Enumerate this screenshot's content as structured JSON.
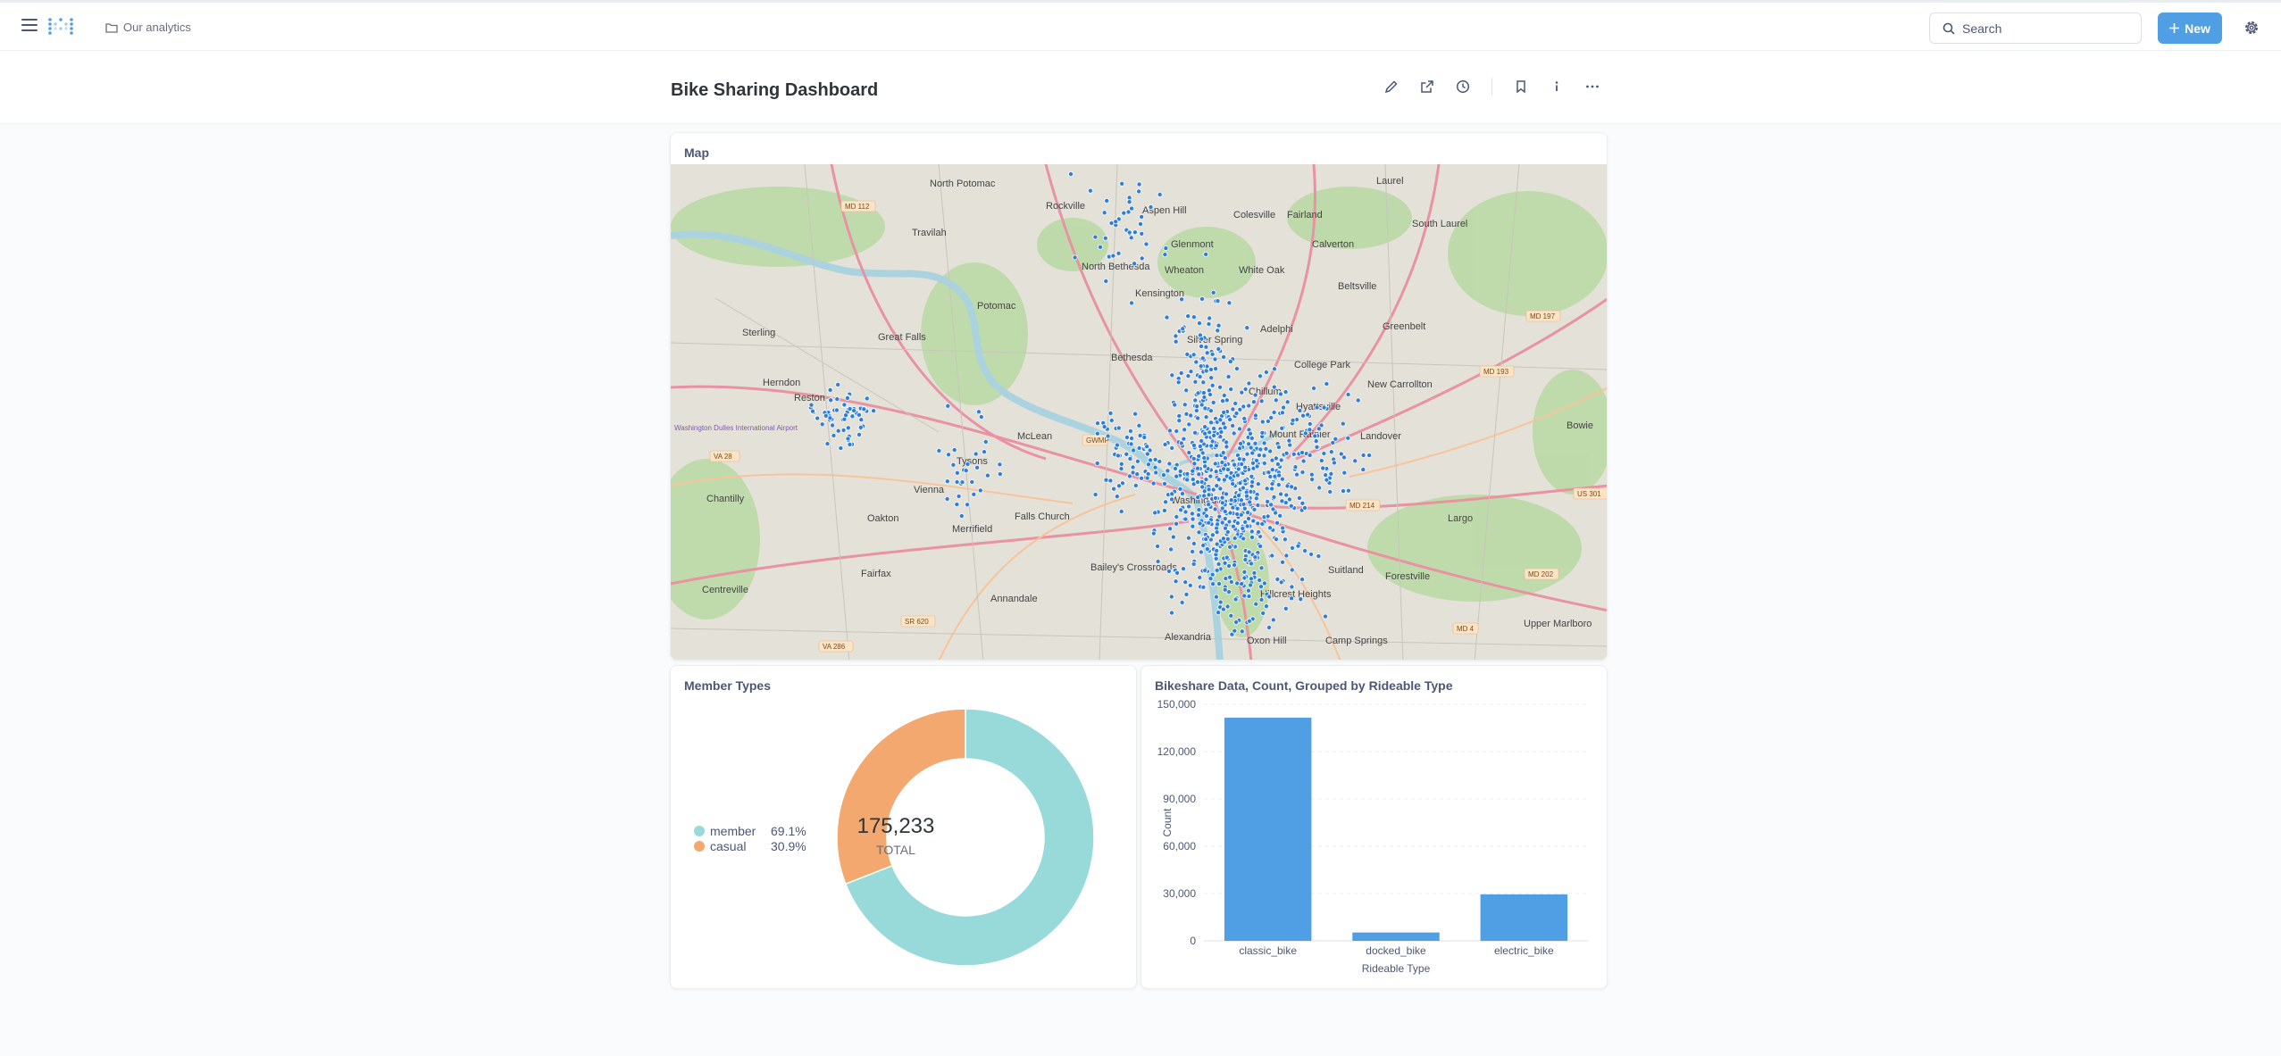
{
  "nav": {
    "breadcrumb": "Our analytics",
    "search_placeholder": "Search",
    "new_label": "New"
  },
  "dashboard": {
    "title": "Bike Sharing Dashboard"
  },
  "map_card": {
    "title": "Map",
    "places": [
      "Laurel",
      "North Potomac",
      "Rockville",
      "Aspen Hill",
      "Colesville",
      "Fairland",
      "South Laurel",
      "Travilah",
      "Glenmont",
      "North Bethesda",
      "Wheaton",
      "White Oak",
      "Calverton",
      "Beltsville",
      "Kensington",
      "Potomac",
      "Bethesda",
      "Silver Spring",
      "Adelphi",
      "College Park",
      "Greenbelt",
      "Great Falls",
      "Sterling",
      "Herndon",
      "Reston",
      "Chillum",
      "Hyattsville",
      "New Carrollton",
      "McLean",
      "Mount Rainier",
      "Landover",
      "Bowie",
      "Chantilly",
      "Vienna",
      "Oakton",
      "Tysons",
      "Falls Church",
      "Merrifield",
      "Washington",
      "Largo",
      "Fairfax",
      "Bailey's Crossroads",
      "Suitland",
      "Forestville",
      "Centreville",
      "Annandale",
      "Hillcrest Heights",
      "Alexandria",
      "Oxon Hill",
      "Camp Springs",
      "Upper Marlboro",
      "Washington Dulles International Airport"
    ],
    "roads": [
      "MD 112",
      "MD 197",
      "MD 193",
      "VA 28",
      "GWMP",
      "MD 214",
      "US 301",
      "MD 202",
      "MD 4",
      "SR 620",
      "VA 286"
    ]
  },
  "pie_card": {
    "title": "Member Types",
    "total": "175,233",
    "total_label": "TOTAL",
    "slices": [
      {
        "label": "member",
        "percent": "69.1%",
        "value": 0.691,
        "color": "#98d9d9"
      },
      {
        "label": "casual",
        "percent": "30.9%",
        "value": 0.309,
        "color": "#f2a86f"
      }
    ]
  },
  "chart_data": {
    "type": "bar",
    "title": "Bikeshare Data, Count, Grouped by Rideable Type",
    "categories": [
      "classic_bike",
      "docked_bike",
      "electric_bike"
    ],
    "values": [
      141500,
      5300,
      29500
    ],
    "xlabel": "Rideable Type",
    "ylabel": "Count",
    "ylim": [
      0,
      150000
    ],
    "yticks": [
      "0",
      "30,000",
      "60,000",
      "90,000",
      "120,000",
      "150,000"
    ],
    "grid": true,
    "color": "#509ee3"
  }
}
